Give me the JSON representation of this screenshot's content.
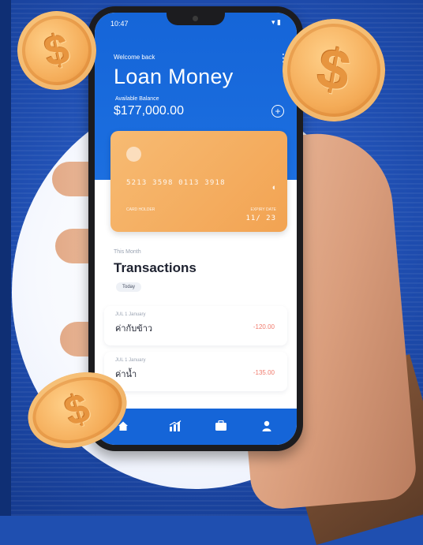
{
  "status_bar": {
    "time": "10:47",
    "icons": "▾ ▮"
  },
  "header": {
    "welcome": "Welcome back",
    "title": "Loan Money",
    "balance_label": "Available Balance",
    "balance": "$177,000.00",
    "add_symbol": "+",
    "more_symbol": "⋮"
  },
  "card": {
    "number": "5213 3598 0113 3918",
    "holder_label": "CARD HOLDER",
    "expiry_label": "EXPIRY DATE",
    "expiry": "11/ 23",
    "contactless_symbol": "◖"
  },
  "transactions": {
    "caption": "This Month",
    "title": "Transactions",
    "filter": "Today",
    "items": [
      {
        "date": "JUL 1 January",
        "name": "ค่ากับข้าว",
        "amount": "-120.00"
      },
      {
        "date": "JUL 1 January",
        "name": "ค่าน้ำ",
        "amount": "-135.00"
      }
    ]
  },
  "bottom_nav": [
    "home",
    "stats",
    "wallet",
    "profile"
  ],
  "coins": {
    "symbol": "$"
  },
  "colors": {
    "brand_blue": "#1565d8",
    "card_orange": "#f4a556",
    "negative": "#f07a6c",
    "coin": "#f4ab57"
  }
}
